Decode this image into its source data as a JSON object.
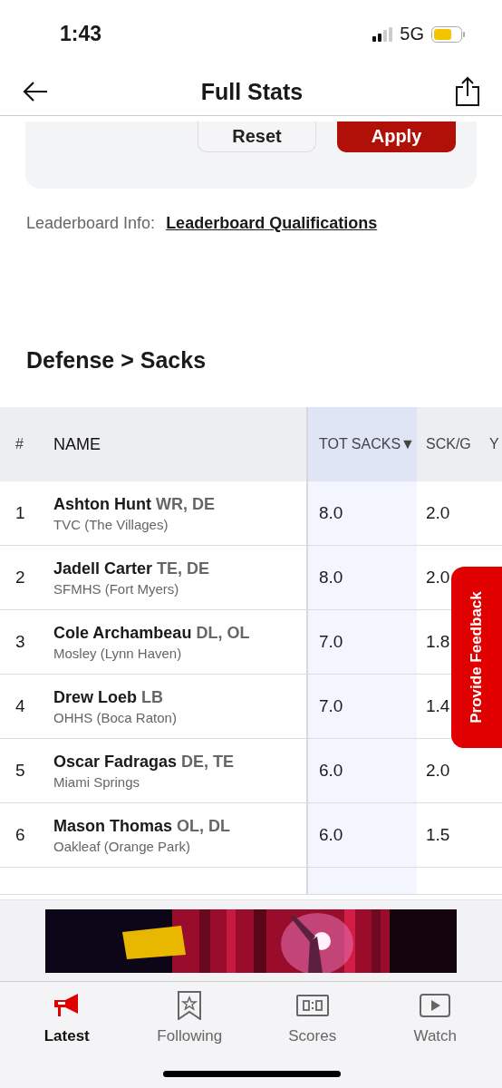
{
  "status_bar": {
    "time": "1:43",
    "network": "5G"
  },
  "header": {
    "title": "Full Stats"
  },
  "filter_panel": {
    "buttons": [
      {
        "label": "Reset",
        "kind": "secondary"
      },
      {
        "label": "Apply",
        "kind": "primary"
      }
    ]
  },
  "leaderboard_info": {
    "label": "Leaderboard Info:",
    "link": "Leaderboard Qualifications"
  },
  "section_title": "Defense > Sacks",
  "table": {
    "columns": [
      {
        "label": "#",
        "sorted": false
      },
      {
        "label": "NAME",
        "sorted": false
      },
      {
        "label": "TOT SACKS",
        "sorted": true,
        "sort_icon": "▼"
      },
      {
        "label": "SCK/G",
        "sorted": false
      },
      {
        "label": "Y",
        "sorted": false
      }
    ],
    "rows": [
      {
        "rank": "1",
        "name": "Ashton Hunt",
        "positions": "WR, DE",
        "school": "TVC (The Villages)",
        "tot_sacks": "8.0",
        "sck_g": "2.0"
      },
      {
        "rank": "2",
        "name": "Jadell Carter",
        "positions": "TE, DE",
        "school": "SFMHS (Fort Myers)",
        "tot_sacks": "8.0",
        "sck_g": "2.0"
      },
      {
        "rank": "3",
        "name": "Cole Archambeau",
        "positions": "DL, OL",
        "school": "Mosley (Lynn Haven)",
        "tot_sacks": "7.0",
        "sck_g": "1.8"
      },
      {
        "rank": "4",
        "name": "Drew Loeb",
        "positions": "LB",
        "school": "OHHS (Boca Raton)",
        "tot_sacks": "7.0",
        "sck_g": "1.4"
      },
      {
        "rank": "5",
        "name": "Oscar Fadragas",
        "positions": "DE, TE",
        "school": "Miami Springs",
        "tot_sacks": "6.0",
        "sck_g": "2.0"
      },
      {
        "rank": "6",
        "name": "Mason Thomas",
        "positions": "OL, DL",
        "school": "Oakleaf (Orange Park)",
        "tot_sacks": "6.0",
        "sck_g": "1.5"
      }
    ]
  },
  "feedback_tab": {
    "label": "Provide Feedback"
  },
  "bottom_nav": [
    {
      "label": "Latest",
      "selected": true
    },
    {
      "label": "Following",
      "selected": false
    },
    {
      "label": "Scores",
      "selected": false
    },
    {
      "label": "Watch",
      "selected": false
    }
  ]
}
